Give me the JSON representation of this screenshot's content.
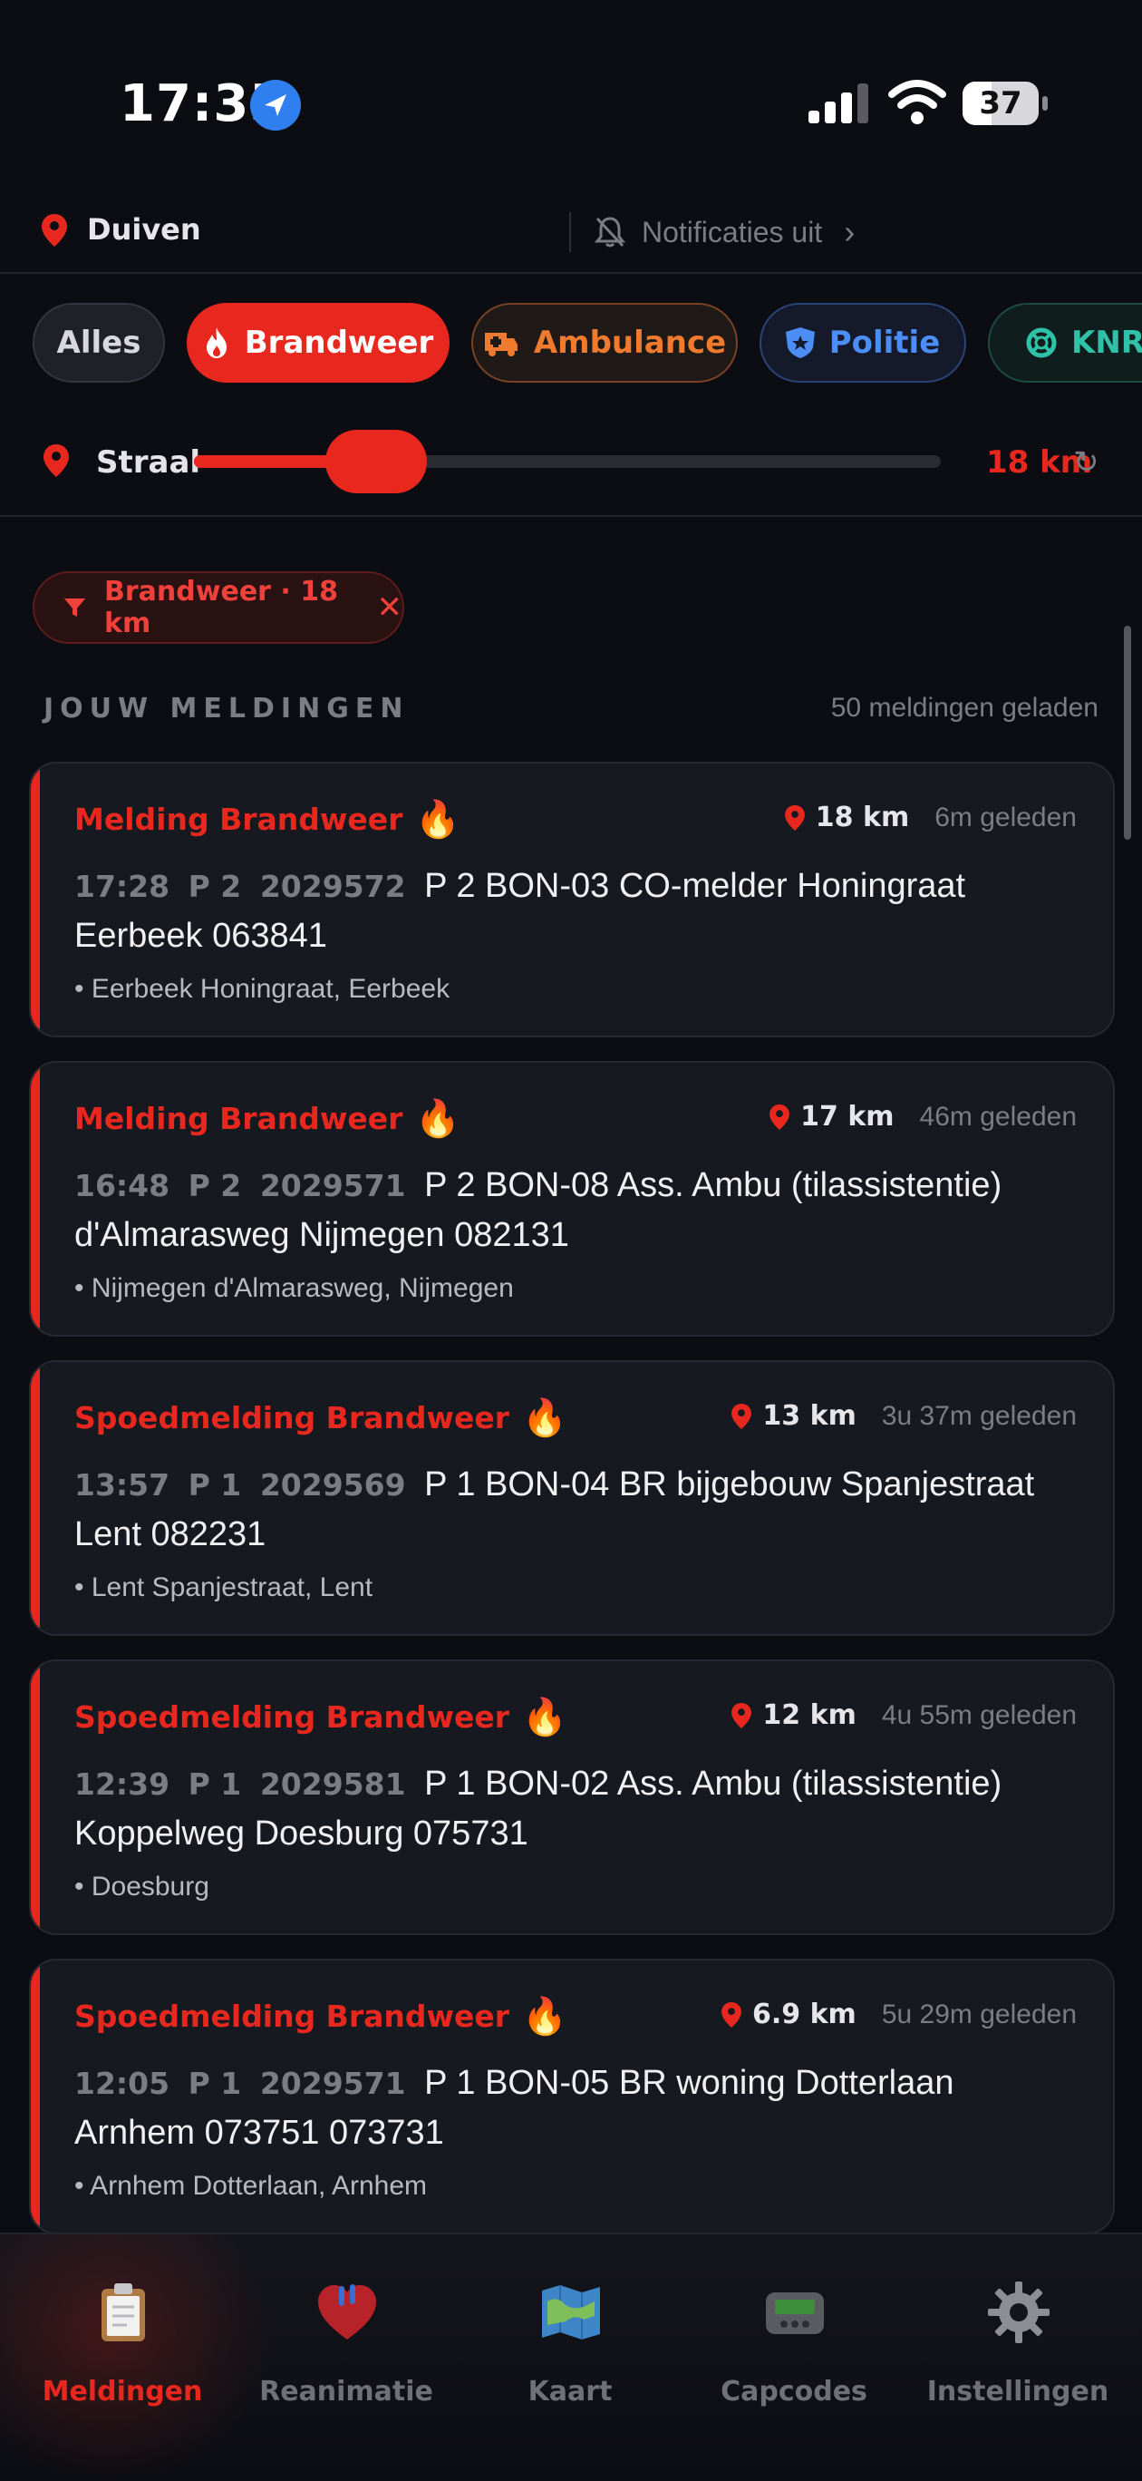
{
  "status_bar": {
    "time": "17:35",
    "battery": "37"
  },
  "location": {
    "name": "Duiven",
    "notifications": "Notificaties uit"
  },
  "chips": [
    {
      "label": "Alles",
      "icon": "none"
    },
    {
      "label": "Brandweer",
      "icon": "flame-icon"
    },
    {
      "label": "Ambulance",
      "icon": "ambulance-icon"
    },
    {
      "label": "Politie",
      "icon": "police-badge-icon"
    },
    {
      "label": "KNRM",
      "icon": "lifebuoy-icon"
    }
  ],
  "radius": {
    "label": "Straal",
    "value": "18 km",
    "level_fraction": 0.22
  },
  "active_filter": {
    "label": "Brandweer · 18 km"
  },
  "section": {
    "title": "JOUW MELDINGEN",
    "count": "50 meldingen geladen"
  },
  "cards": [
    {
      "title": "Melding Brandweer",
      "distance": "18 km",
      "ago": "6m geleden",
      "time": "17:28",
      "prio": "P 2",
      "capcode": "2029572",
      "message": "P 2 BON-03 CO-melder Honingraat Eerbeek 063841",
      "address": "• Eerbeek Honingraat, Eerbeek"
    },
    {
      "title": "Melding Brandweer",
      "distance": "17 km",
      "ago": "46m geleden",
      "time": "16:48",
      "prio": "P 2",
      "capcode": "2029571",
      "message": "P 2 BON-08 Ass. Ambu (tilassistentie) d'Almarasweg Nijmegen 082131",
      "address": "• Nijmegen d'Almarasweg, Nijmegen"
    },
    {
      "title": "Spoedmelding Brandweer",
      "distance": "13 km",
      "ago": "3u 37m geleden",
      "time": "13:57",
      "prio": "P 1",
      "capcode": "2029569",
      "message": "P 1 BON-04 BR bijgebouw Spanjestraat Lent 082231",
      "address": "• Lent Spanjestraat, Lent"
    },
    {
      "title": "Spoedmelding Brandweer",
      "distance": "12 km",
      "ago": "4u 55m geleden",
      "time": "12:39",
      "prio": "P 1",
      "capcode": "2029581",
      "message": "P 1 BON-02 Ass. Ambu (tilassistentie) Koppelweg Doesburg 075731",
      "address": "• Doesburg"
    },
    {
      "title": "Spoedmelding Brandweer",
      "distance": "6.9 km",
      "ago": "5u 29m geleden",
      "time": "12:05",
      "prio": "P 1",
      "capcode": "2029571",
      "message": "P 1 BON-05 BR woning Dotterlaan Arnhem 073751 073731",
      "address": "• Arnhem Dotterlaan, Arnhem"
    }
  ],
  "tabs": [
    {
      "label": "Meldingen",
      "icon": "clipboard-icon",
      "active": true
    },
    {
      "label": "Reanimatie",
      "icon": "heart-icon",
      "active": false
    },
    {
      "label": "Kaart",
      "icon": "map-icon",
      "active": false
    },
    {
      "label": "Capcodes",
      "icon": "pager-icon",
      "active": false
    },
    {
      "label": "Instellingen",
      "icon": "gear-icon",
      "active": false
    }
  ],
  "colors": {
    "accent": "#e8281f",
    "ambulance": "#f07a2e",
    "police": "#4c8ef5",
    "knrm": "#2fc2a8",
    "background": "#0c0d12"
  }
}
